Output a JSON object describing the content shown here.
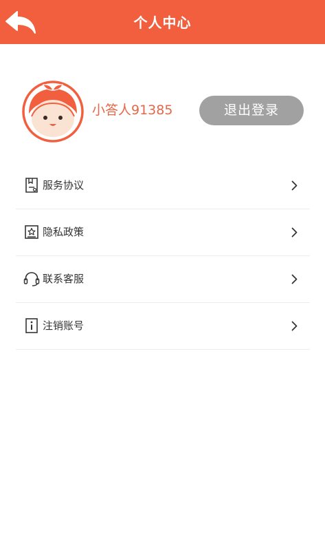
{
  "header": {
    "title": "个人中心",
    "back_icon": "back-arrow-icon",
    "background_color": "#f25f3f"
  },
  "profile": {
    "username": "小答人91385",
    "username_color": "#e4674a",
    "avatar_icon": "cartoon-face-avatar-icon",
    "logout_label": "退出登录",
    "logout_button_color": "#a1a1a1"
  },
  "menu": {
    "items": [
      {
        "label": "服务协议",
        "icon": "document-icon"
      },
      {
        "label": "隐私政策",
        "icon": "privacy-star-icon"
      },
      {
        "label": "联系客服",
        "icon": "headset-icon"
      },
      {
        "label": "注销账号",
        "icon": "info-icon"
      }
    ],
    "chevron_icon": "chevron-right-icon"
  }
}
